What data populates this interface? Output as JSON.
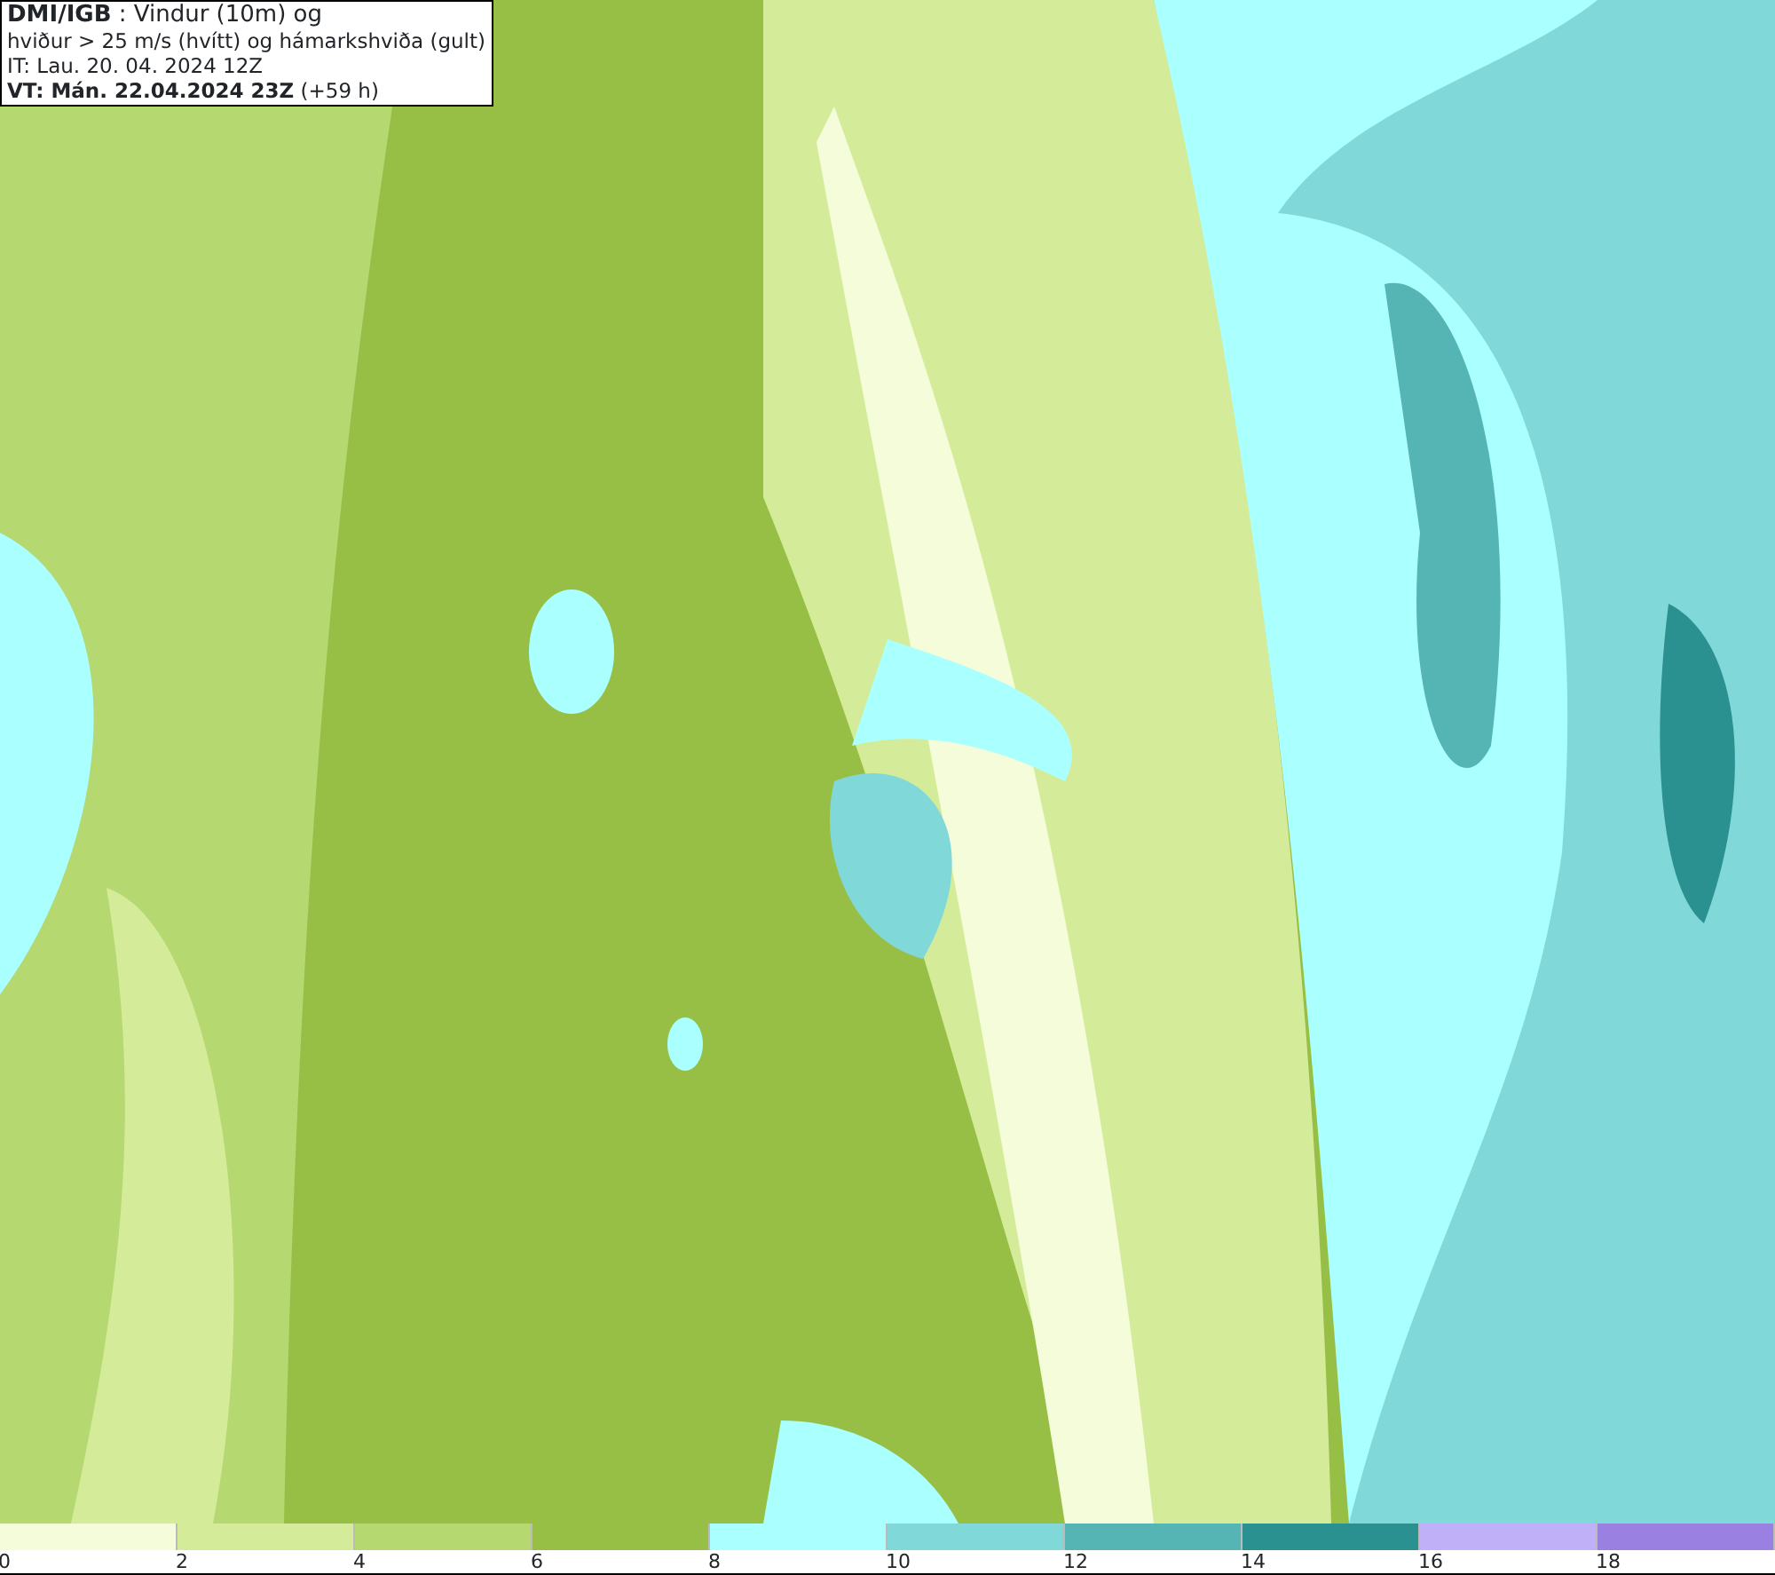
{
  "info_box": {
    "lines": [
      "**DMI/IGB** : Vindur (10m) og",
      "hviður > 25 m/s (hvítt) og hámarkshviða (gult)",
      "IT: Lau. 20. 04. 2024 12Z",
      "**VT: Mán. 22.04.2024 23Z** (+59 h)"
    ]
  },
  "legend": [
    {
      "label": "0",
      "color": "#f5fcd9"
    },
    {
      "label": "2",
      "color": "#d4ec9a"
    },
    {
      "label": "4",
      "color": "#b5d870"
    },
    {
      "label": "6",
      "color": "#98bf45"
    },
    {
      "label": "8",
      "color": "#aaffff"
    },
    {
      "label": "10",
      "color": "#80d8d8"
    },
    {
      "label": "12",
      "color": "#55b5b5"
    },
    {
      "label": "14",
      "color": "#2a9090"
    },
    {
      "label": "16",
      "color": "#c0b0f8"
    },
    {
      "label": "18",
      "color": "#9a80e0"
    }
  ]
}
